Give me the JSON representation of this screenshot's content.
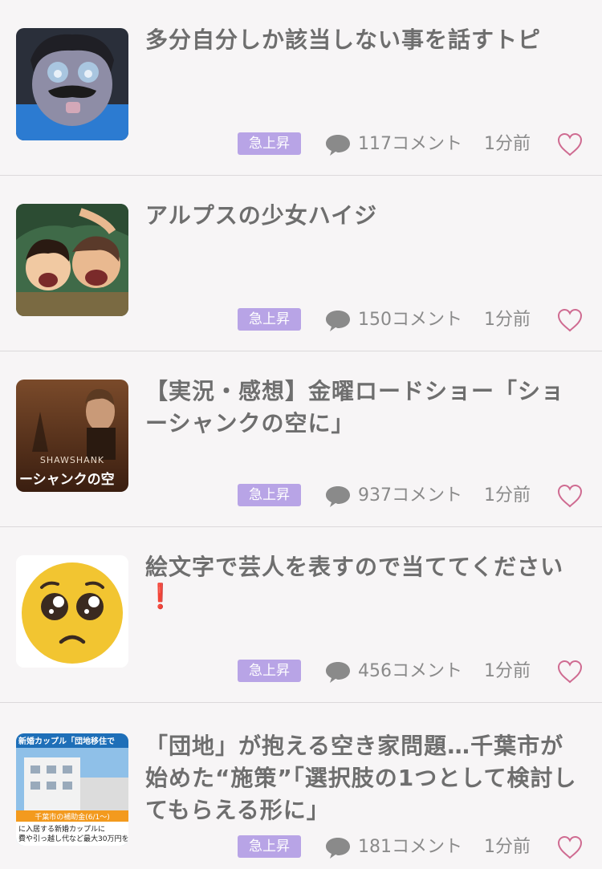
{
  "colors": {
    "badge": "#b8a4e6",
    "heart": "#cf6b91",
    "text": "#6e6e6e",
    "meta": "#8a8a8a"
  },
  "items": [
    {
      "title": "多分自分しか該当しない事を話すトピ",
      "badge": "急上昇",
      "comments": "117コメント",
      "time": "1分前",
      "thumb_icon": "cartoon-face-thumbnail"
    },
    {
      "title": "アルプスの少女ハイジ",
      "badge": "急上昇",
      "comments": "150コメント",
      "time": "1分前",
      "thumb_icon": "anime-heidi-thumbnail"
    },
    {
      "title": "【実況・感想】金曜ロードショー「ショーシャンクの空に」",
      "badge": "急上昇",
      "comments": "937コメント",
      "time": "1分前",
      "thumb_icon": "movie-poster-thumbnail",
      "thumb_text_1": "SHAWSHANK",
      "thumb_text_2": "ーシャンクの空"
    },
    {
      "title": "絵文字で芸人を表すので当ててください",
      "title_suffix": "❗",
      "badge": "急上昇",
      "comments": "456コメント",
      "time": "1分前",
      "thumb_icon": "pleading-face-emoji-thumbnail"
    },
    {
      "title": "「団地」が抱える空き家問題…千葉市が始めた“施策”「選択肢の1つとして検討してもらえる形に」",
      "badge": "急上昇",
      "comments": "181コメント",
      "time": "1分前",
      "thumb_icon": "news-building-thumbnail",
      "thumb_text_1": "新婚カップル「団地移住で",
      "thumb_text_2": "千葉市の補助金(6/1〜)",
      "thumb_text_3": "に入居する新婚カップルに",
      "thumb_text_4": "費や引っ越し代など最大30万円を"
    }
  ]
}
